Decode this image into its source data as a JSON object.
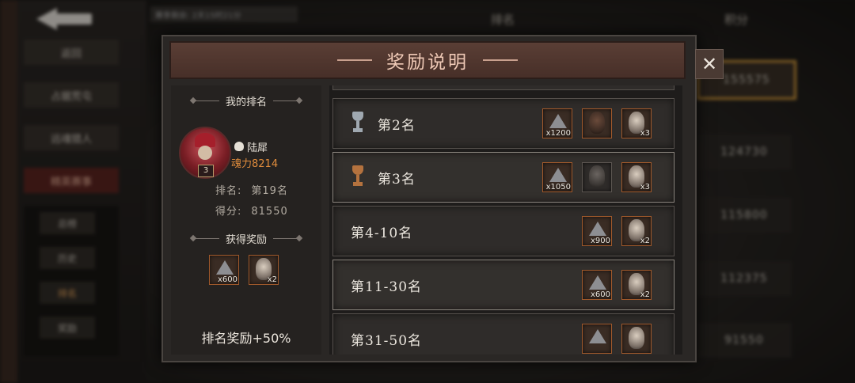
{
  "background": {
    "menu": [
      "返回",
      "占据荒屯",
      "远魂猎人",
      "精英赛事"
    ],
    "submenu": [
      "总榜",
      "历史",
      "排名",
      "奖励"
    ],
    "columns": [
      "排名",
      "积分"
    ],
    "scores": [
      "155575",
      "124730",
      "115800",
      "112375",
      "91550"
    ],
    "topbar_text": "赛季剩余: 2天15时21分"
  },
  "modal": {
    "title": "奖励说明",
    "close_label": "✕"
  },
  "my_rank": {
    "header": "我的排名",
    "avatar_level": "3",
    "player_name": "陆犀",
    "power": "魂力8214",
    "rank_label": "排名:",
    "rank_value": "第19名",
    "score_label": "得分:",
    "score_value": "81550",
    "rewards_header": "获得奖励",
    "rewards": [
      {
        "type": "gem",
        "qty": "x600"
      },
      {
        "type": "mask",
        "qty": "x2"
      }
    ],
    "bonus": "排名奖励+50%"
  },
  "rank_rewards": [
    {
      "label": "第2名",
      "trophy": "silver-trophy-icon",
      "rewards": [
        {
          "type": "gem",
          "qty": "x1200"
        },
        {
          "type": "mask-brown",
          "qty": ""
        },
        {
          "type": "mask",
          "qty": "x3"
        }
      ]
    },
    {
      "label": "第3名",
      "trophy": "bronze-trophy-icon",
      "rewards": [
        {
          "type": "gem",
          "qty": "x1050"
        },
        {
          "type": "mask-dark",
          "qty": ""
        },
        {
          "type": "mask",
          "qty": "x3"
        }
      ]
    },
    {
      "label": "第4-10名",
      "rewards": [
        {
          "type": "gem",
          "qty": "x900"
        },
        {
          "type": "mask",
          "qty": "x2"
        }
      ]
    },
    {
      "label": "第11-30名",
      "rewards": [
        {
          "type": "gem",
          "qty": "x600"
        },
        {
          "type": "mask",
          "qty": "x2"
        }
      ]
    },
    {
      "label": "第31-50名",
      "rewards": [
        {
          "type": "gem",
          "qty": ""
        },
        {
          "type": "mask",
          "qty": ""
        }
      ]
    }
  ],
  "colors": {
    "accent_orange": "#e08c3c",
    "title_bar": "#5a3e35",
    "item_border": "#a0592b"
  }
}
